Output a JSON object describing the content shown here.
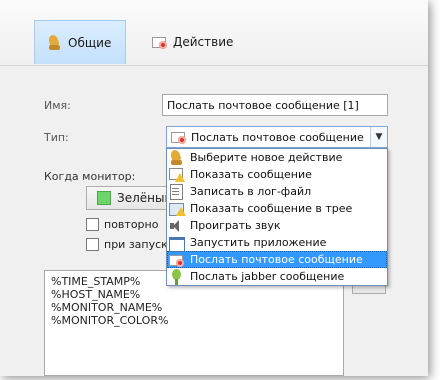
{
  "tabs": [
    {
      "label": "Общие",
      "icon": "wizard-icon",
      "active": true
    },
    {
      "label": "Действие",
      "icon": "mail-icon",
      "active": false
    }
  ],
  "form": {
    "name_label": "Имя:",
    "name_value": "Послать почтовое сообщение [1]",
    "type_label": "Тип:",
    "type_value": "Послать почтовое сообщение",
    "when_label": "Когда монитор:",
    "status_button": "Зелёный",
    "repeat_label": "повторно",
    "on_start_label": "при запуске"
  },
  "template_lines": [
    "%TIME_STAMP%",
    "%HOST_NAME%",
    "%MONITOR_NAME%",
    "%MONITOR_COLOR%"
  ],
  "dropdown": {
    "items": [
      {
        "label": "Выберите новое действие",
        "icon": "wizard-icon"
      },
      {
        "label": "Показать сообщение",
        "icon": "message-icon"
      },
      {
        "label": "Записать в лог-файл",
        "icon": "log-icon"
      },
      {
        "label": "Показать сообщение в трее",
        "icon": "tray-icon"
      },
      {
        "label": "Проиграть звук",
        "icon": "sound-icon"
      },
      {
        "label": "Запустить приложение",
        "icon": "app-icon"
      },
      {
        "label": "Послать почтовое сообщение",
        "icon": "mail-icon",
        "selected": true
      },
      {
        "label": "Послать jabber сообщение",
        "icon": "jabber-icon"
      }
    ]
  },
  "colors": {
    "accent": "#3399ff",
    "status_green": "#6fd46b",
    "tab_active": "#c4e0fb"
  }
}
